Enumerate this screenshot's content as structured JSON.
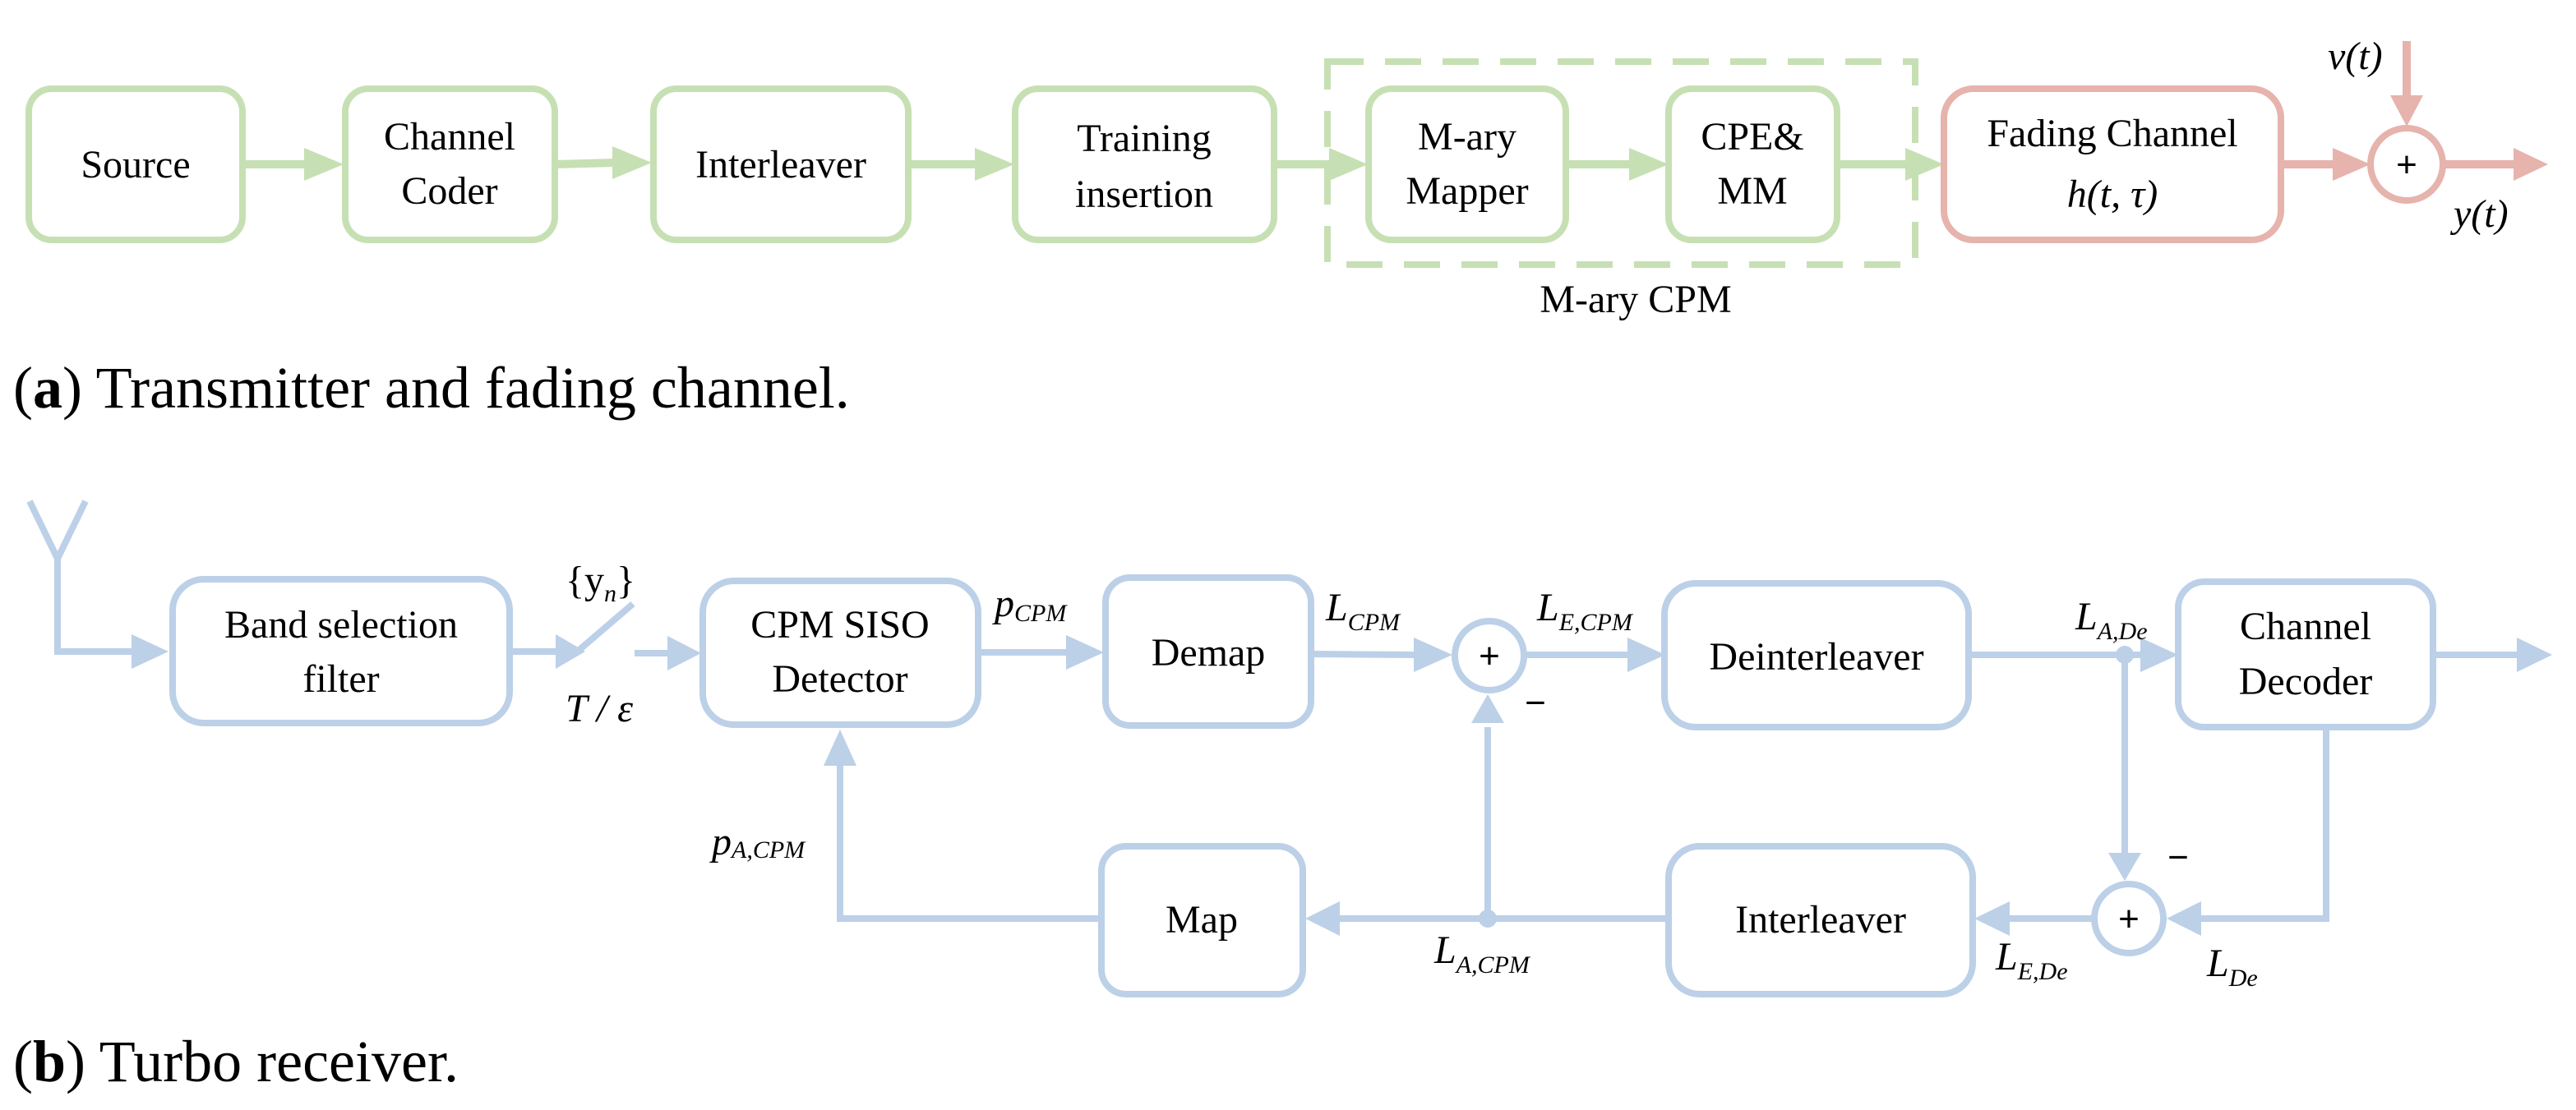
{
  "colors": {
    "transmitter_green": "#c6e0b4",
    "channel_red": "#e6b3ad",
    "receiver_blue": "#bcd0e8",
    "text": "#000000"
  },
  "transmitter": {
    "blocks": {
      "source": [
        "Source"
      ],
      "channel_coder": [
        "Channel",
        "Coder"
      ],
      "interleaver": [
        "Interleaver"
      ],
      "training_insertion": [
        "Training",
        "insertion"
      ],
      "mary_mapper": [
        "M-ary",
        "Mapper"
      ],
      "cpe_mm": [
        "CPE&",
        "MM"
      ],
      "fading_channel": [
        "Fading Channel",
        "h(t, τ)"
      ]
    },
    "group_label": "M-ary CPM",
    "sum_symbol": "+",
    "noise_label": "v(t)",
    "output_label": "y(t)",
    "caption": {
      "letter": "a",
      "open": "(",
      "close": ")",
      "text": " Transmitter and fading channel."
    }
  },
  "receiver": {
    "blocks": {
      "band_selection_filter": [
        "Band selection",
        "filter"
      ],
      "cpm_siso_detector": [
        "CPM SISO",
        "Detector"
      ],
      "demap": [
        "Demap"
      ],
      "deinterleaver": [
        "Deinterleaver"
      ],
      "channel_decoder": [
        "Channel",
        "Decoder"
      ],
      "map": [
        "Map"
      ],
      "interleaver": [
        "Interleaver"
      ]
    },
    "sampler": {
      "top": "{y",
      "top_sub": "n",
      "top_close": "}",
      "bottom": "T / ε"
    },
    "signals": {
      "p_cpm": {
        "main": "p",
        "sub": "CPM"
      },
      "l_cpm": {
        "main": "L",
        "sub": "CPM"
      },
      "l_e_cpm": {
        "main": "L",
        "sub": "E,CPM"
      },
      "l_a_de": {
        "main": "L",
        "sub": "A,De"
      },
      "p_a_cpm": {
        "main": "p",
        "sub": "A,CPM"
      },
      "l_a_cpm": {
        "main": "L",
        "sub": "A,CPM"
      },
      "l_e_de": {
        "main": "L",
        "sub": "E,De"
      },
      "l_de": {
        "main": "L",
        "sub": "De"
      }
    },
    "sum_symbol": "+",
    "minus_symbol": "−",
    "caption": {
      "letter": "b",
      "open": "(",
      "close": ")",
      "text": " Turbo receiver."
    }
  }
}
